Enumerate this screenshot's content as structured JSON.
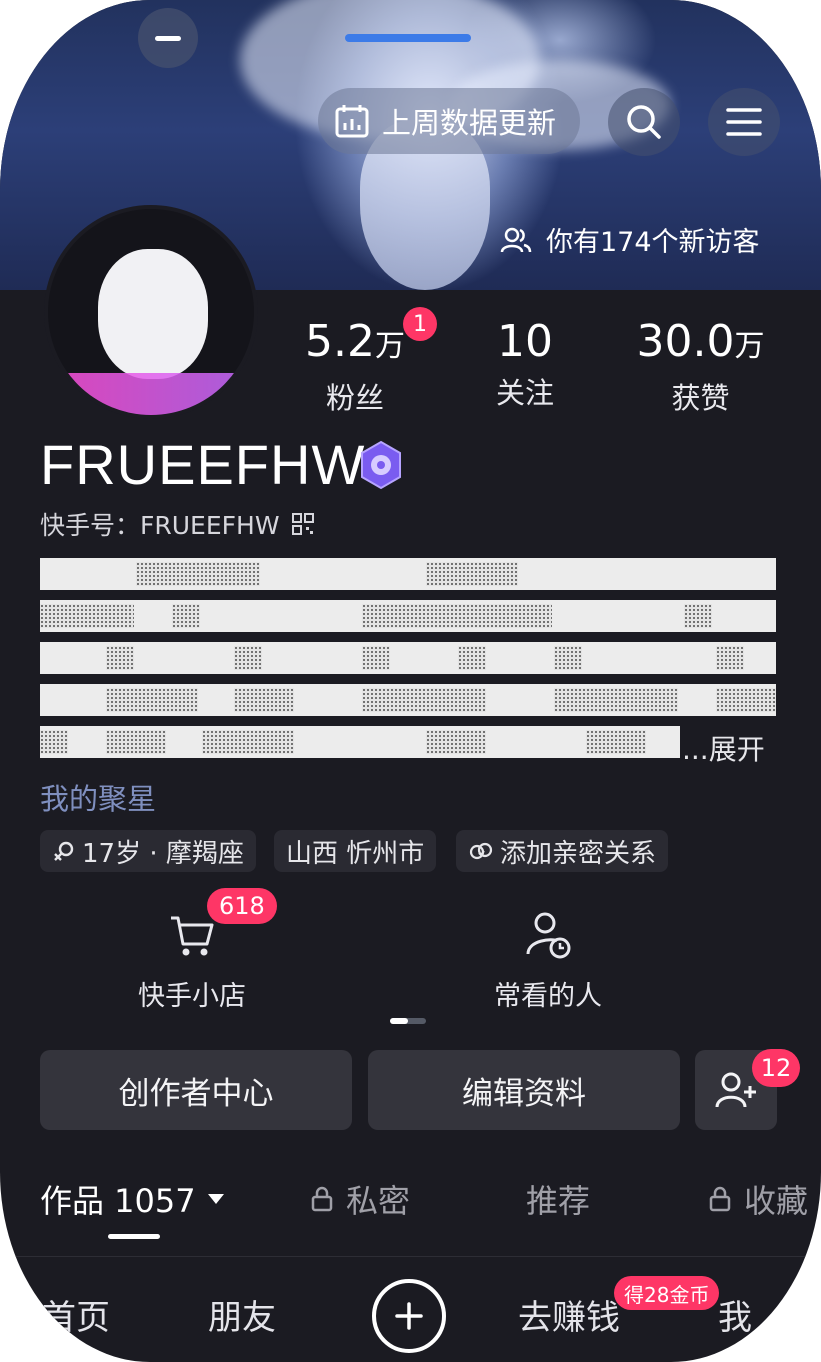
{
  "header": {
    "update_label": "上周数据更新",
    "visitors_text": "你有174个新访客"
  },
  "stats": [
    {
      "value": "5.2",
      "unit": "万",
      "label": "粉丝",
      "badge": "1"
    },
    {
      "value": "10",
      "unit": "",
      "label": "关注"
    },
    {
      "value": "30.0",
      "unit": "万",
      "label": "获赞"
    }
  ],
  "profile": {
    "name": "FRUEEFHW",
    "kuaishou_id": "快手号：FRUEEFHW",
    "expand": "...展开",
    "stars_link": "我的聚星"
  },
  "tags": [
    {
      "icon": "gender-icon",
      "label": "17岁 · 摩羯座"
    },
    {
      "icon": "",
      "label": "山西 忻州市"
    },
    {
      "icon": "heart-link-icon",
      "label": "添加亲密关系"
    }
  ],
  "shortcuts": [
    {
      "icon": "cart-icon",
      "label": "快手小店",
      "badge": "618"
    },
    {
      "icon": "recent-people-icon",
      "label": "常看的人"
    }
  ],
  "actions": {
    "creator_center": "创作者中心",
    "edit_profile": "编辑资料",
    "add_friend_badge": "12"
  },
  "tabs": [
    {
      "label": "作品 1057",
      "active": true
    },
    {
      "label": "私密",
      "locked": true
    },
    {
      "label": "推荐"
    },
    {
      "label": "收藏",
      "locked": true
    }
  ],
  "bottom_nav": [
    {
      "label": "首页"
    },
    {
      "label": "朋友"
    },
    {
      "label": "+"
    },
    {
      "label": "去赚钱",
      "badge": "得28金币"
    },
    {
      "label": "我"
    }
  ],
  "colors": {
    "background": "#1b1b22",
    "badge": "#fe3666",
    "link": "#7f8fbf",
    "indicator": "#3c7be8"
  }
}
